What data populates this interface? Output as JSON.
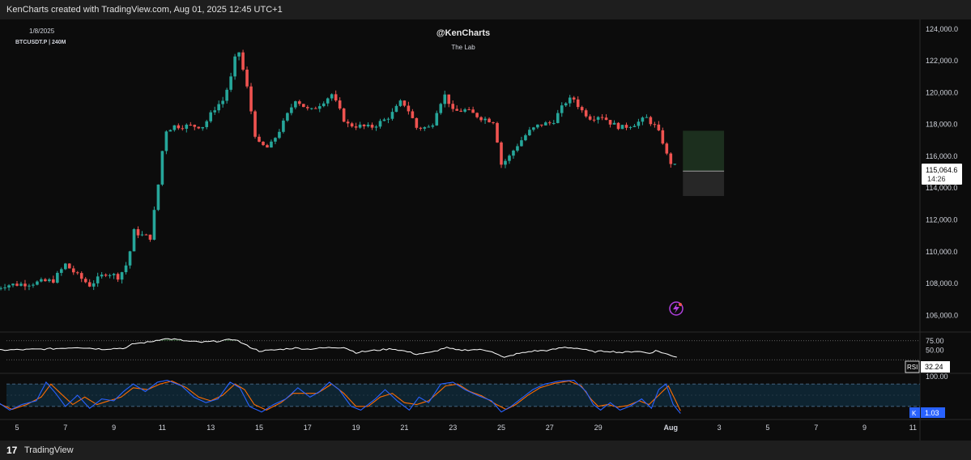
{
  "header": {
    "attribution": "KenCharts created with TradingView.com, Aug 01, 2025 12:45 UTC+1"
  },
  "footer": {
    "logo": "17",
    "brand": "TradingView"
  },
  "chart_info": {
    "date": "1/8/2025",
    "symbol": "BTCUSDT.P | 240M",
    "watermark_title": "@KenCharts",
    "watermark_sub": "The Lab"
  },
  "colors": {
    "up": "#26a69a",
    "down": "#ef5350",
    "rsi_line": "#ffffff",
    "stoch_k": "#2962ff",
    "stoch_d": "#ff6d00",
    "stoch_band": "#0f2a3b"
  },
  "price_label": {
    "value": "115,064.6",
    "countdown": "14:26"
  },
  "rsi_label": {
    "name": "RSI",
    "value": "32.24"
  },
  "stoch_label": {
    "name": "K",
    "value": "1.03"
  },
  "chart_data": [
    {
      "type": "candlestick",
      "title": "BTCUSDT.P | 240M",
      "x_ticks": [
        "5",
        "7",
        "9",
        "11",
        "13",
        "15",
        "17",
        "19",
        "21",
        "23",
        "25",
        "27",
        "29",
        "Aug",
        "3",
        "5",
        "7",
        "9",
        "11"
      ],
      "x_tick_days": [
        5,
        7,
        9,
        11,
        13,
        15,
        17,
        19,
        21,
        23,
        25,
        27,
        29,
        32,
        34,
        36,
        38,
        40,
        42
      ],
      "ylim": [
        105000,
        124600
      ],
      "y_ticks": [
        "124,000.0",
        "122,000.0",
        "120,000.0",
        "118,000.0",
        "116,000.0",
        "114,000.0",
        "112,000.0",
        "110,000.0",
        "108,000.0",
        "106,000.0"
      ],
      "y_tick_values": [
        124000,
        122000,
        120000,
        118000,
        116000,
        114000,
        112000,
        110000,
        108000,
        106000
      ],
      "close_keypoints": [
        [
          4.0,
          107600
        ],
        [
          4.5,
          107900
        ],
        [
          5.5,
          108000
        ],
        [
          6.5,
          108200
        ],
        [
          7.0,
          109200
        ],
        [
          7.5,
          108500
        ],
        [
          8.0,
          107900
        ],
        [
          8.7,
          108700
        ],
        [
          9.2,
          108400
        ],
        [
          9.6,
          109400
        ],
        [
          9.8,
          111300
        ],
        [
          10.2,
          111000
        ],
        [
          10.5,
          110900
        ],
        [
          10.8,
          113800
        ],
        [
          11.1,
          117600
        ],
        [
          11.5,
          117900
        ],
        [
          12.0,
          117900
        ],
        [
          12.7,
          117900
        ],
        [
          13.2,
          119100
        ],
        [
          13.5,
          119500
        ],
        [
          13.9,
          121200
        ],
        [
          14.1,
          123000
        ],
        [
          14.5,
          120300
        ],
        [
          14.9,
          116800
        ],
        [
          15.4,
          116500
        ],
        [
          15.9,
          117800
        ],
        [
          16.5,
          119600
        ],
        [
          17.1,
          118800
        ],
        [
          17.6,
          119400
        ],
        [
          18.0,
          119900
        ],
        [
          18.6,
          118000
        ],
        [
          19.1,
          117900
        ],
        [
          19.6,
          117800
        ],
        [
          20.2,
          118300
        ],
        [
          20.5,
          118700
        ],
        [
          20.9,
          119500
        ],
        [
          21.2,
          118800
        ],
        [
          21.5,
          117800
        ],
        [
          22.1,
          117800
        ],
        [
          22.4,
          119200
        ],
        [
          22.7,
          119900
        ],
        [
          23.0,
          118800
        ],
        [
          23.5,
          118900
        ],
        [
          24.2,
          118400
        ],
        [
          24.7,
          118200
        ],
        [
          25.0,
          115500
        ],
        [
          25.3,
          115900
        ],
        [
          25.6,
          116600
        ],
        [
          26.1,
          117500
        ],
        [
          26.6,
          118000
        ],
        [
          27.1,
          118100
        ],
        [
          27.7,
          119500
        ],
        [
          28.0,
          119600
        ],
        [
          28.3,
          118900
        ],
        [
          28.7,
          118400
        ],
        [
          29.1,
          118600
        ],
        [
          29.6,
          118000
        ],
        [
          30.0,
          117800
        ],
        [
          30.6,
          118100
        ],
        [
          31.0,
          118400
        ],
        [
          31.4,
          117800
        ],
        [
          31.7,
          116800
        ],
        [
          31.9,
          115700
        ],
        [
          32.1,
          115500
        ],
        [
          32.3,
          115100
        ]
      ],
      "rsi": {
        "name": "RSI",
        "value": 32.24,
        "levels": [
          75,
          50,
          25
        ],
        "range": [
          0,
          100
        ],
        "keypoints": [
          [
            4.0,
            50
          ],
          [
            5.5,
            52
          ],
          [
            6.5,
            54
          ],
          [
            7.5,
            58
          ],
          [
            8.5,
            53
          ],
          [
            9.5,
            56
          ],
          [
            9.8,
            67
          ],
          [
            10.5,
            72
          ],
          [
            11.0,
            80
          ],
          [
            11.5,
            79
          ],
          [
            12.0,
            74
          ],
          [
            12.6,
            71
          ],
          [
            13.3,
            74
          ],
          [
            14.0,
            79
          ],
          [
            14.5,
            62
          ],
          [
            15.0,
            48
          ],
          [
            15.5,
            50
          ],
          [
            16.5,
            56
          ],
          [
            17.0,
            53
          ],
          [
            17.6,
            56
          ],
          [
            18.5,
            58
          ],
          [
            19.0,
            44
          ],
          [
            19.5,
            48
          ],
          [
            20.5,
            54
          ],
          [
            21.0,
            48
          ],
          [
            21.5,
            40
          ],
          [
            22.1,
            44
          ],
          [
            22.7,
            57
          ],
          [
            23.2,
            50
          ],
          [
            24.0,
            52
          ],
          [
            24.6,
            48
          ],
          [
            25.1,
            30
          ],
          [
            25.6,
            40
          ],
          [
            26.3,
            48
          ],
          [
            27.0,
            50
          ],
          [
            27.6,
            58
          ],
          [
            28.2,
            55
          ],
          [
            28.8,
            46
          ],
          [
            29.4,
            48
          ],
          [
            30.0,
            44
          ],
          [
            30.6,
            48
          ],
          [
            31.1,
            42
          ],
          [
            31.4,
            49
          ],
          [
            31.7,
            43
          ],
          [
            32.0,
            36
          ],
          [
            32.3,
            32.24
          ]
        ]
      },
      "stoch_rsi": {
        "k_name": "K",
        "k_value": 1.03,
        "levels": [
          80,
          20
        ],
        "range": [
          0,
          100
        ],
        "k_keypoints": [
          [
            4.0,
            40
          ],
          [
            4.7,
            10
          ],
          [
            5.2,
            25
          ],
          [
            5.8,
            35
          ],
          [
            6.2,
            85
          ],
          [
            6.6,
            55
          ],
          [
            7.0,
            20
          ],
          [
            7.5,
            50
          ],
          [
            8.0,
            15
          ],
          [
            8.5,
            40
          ],
          [
            9.0,
            35
          ],
          [
            9.4,
            60
          ],
          [
            9.8,
            80
          ],
          [
            10.3,
            60
          ],
          [
            10.8,
            85
          ],
          [
            11.2,
            90
          ],
          [
            11.8,
            75
          ],
          [
            12.3,
            45
          ],
          [
            12.8,
            30
          ],
          [
            13.3,
            40
          ],
          [
            13.8,
            85
          ],
          [
            14.2,
            70
          ],
          [
            14.6,
            20
          ],
          [
            15.1,
            5
          ],
          [
            15.6,
            25
          ],
          [
            16.1,
            40
          ],
          [
            16.6,
            70
          ],
          [
            17.1,
            45
          ],
          [
            17.5,
            60
          ],
          [
            17.9,
            85
          ],
          [
            18.3,
            65
          ],
          [
            18.8,
            20
          ],
          [
            19.2,
            10
          ],
          [
            19.8,
            40
          ],
          [
            20.2,
            65
          ],
          [
            20.7,
            35
          ],
          [
            21.2,
            10
          ],
          [
            21.6,
            45
          ],
          [
            22.0,
            30
          ],
          [
            22.5,
            80
          ],
          [
            23.0,
            85
          ],
          [
            23.5,
            65
          ],
          [
            24.0,
            50
          ],
          [
            24.6,
            35
          ],
          [
            25.0,
            5
          ],
          [
            25.4,
            20
          ],
          [
            25.8,
            40
          ],
          [
            26.3,
            65
          ],
          [
            26.8,
            80
          ],
          [
            27.4,
            88
          ],
          [
            28.0,
            90
          ],
          [
            28.5,
            60
          ],
          [
            28.8,
            25
          ],
          [
            29.1,
            10
          ],
          [
            29.5,
            30
          ],
          [
            29.9,
            10
          ],
          [
            30.3,
            20
          ],
          [
            30.8,
            40
          ],
          [
            31.2,
            15
          ],
          [
            31.5,
            65
          ],
          [
            31.8,
            80
          ],
          [
            32.1,
            25
          ],
          [
            32.4,
            1.03
          ]
        ],
        "d_keypoints": [
          [
            4.0,
            35
          ],
          [
            4.8,
            12
          ],
          [
            5.4,
            25
          ],
          [
            6.0,
            45
          ],
          [
            6.4,
            80
          ],
          [
            6.8,
            55
          ],
          [
            7.3,
            25
          ],
          [
            7.8,
            45
          ],
          [
            8.3,
            25
          ],
          [
            8.8,
            35
          ],
          [
            9.3,
            45
          ],
          [
            9.8,
            70
          ],
          [
            10.4,
            65
          ],
          [
            10.9,
            80
          ],
          [
            11.4,
            88
          ],
          [
            12.0,
            70
          ],
          [
            12.5,
            45
          ],
          [
            13.0,
            35
          ],
          [
            13.5,
            50
          ],
          [
            14.0,
            80
          ],
          [
            14.4,
            65
          ],
          [
            14.8,
            25
          ],
          [
            15.3,
            10
          ],
          [
            15.9,
            30
          ],
          [
            16.4,
            55
          ],
          [
            16.9,
            55
          ],
          [
            17.4,
            55
          ],
          [
            18.0,
            80
          ],
          [
            18.5,
            55
          ],
          [
            19.0,
            20
          ],
          [
            19.5,
            20
          ],
          [
            20.0,
            45
          ],
          [
            20.5,
            55
          ],
          [
            21.0,
            30
          ],
          [
            21.5,
            25
          ],
          [
            22.0,
            35
          ],
          [
            22.7,
            75
          ],
          [
            23.2,
            80
          ],
          [
            23.7,
            60
          ],
          [
            24.2,
            48
          ],
          [
            24.8,
            25
          ],
          [
            25.2,
            12
          ],
          [
            25.6,
            25
          ],
          [
            26.1,
            50
          ],
          [
            26.6,
            70
          ],
          [
            27.2,
            82
          ],
          [
            27.8,
            88
          ],
          [
            28.3,
            75
          ],
          [
            28.7,
            40
          ],
          [
            29.0,
            20
          ],
          [
            29.4,
            25
          ],
          [
            29.8,
            18
          ],
          [
            30.2,
            22
          ],
          [
            30.7,
            35
          ],
          [
            31.1,
            25
          ],
          [
            31.5,
            50
          ],
          [
            31.9,
            75
          ],
          [
            32.2,
            35
          ],
          [
            32.4,
            8
          ]
        ]
      },
      "projection_box": {
        "from_day": 32.5,
        "to_day": 34.2,
        "top": 117600,
        "bottom": 113500,
        "mid": 115064.6
      }
    }
  ]
}
